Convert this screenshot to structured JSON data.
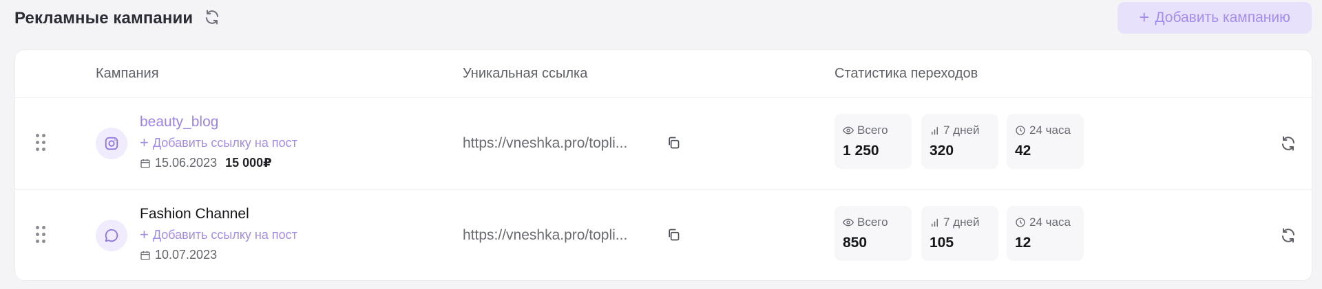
{
  "header": {
    "title": "Рекламные кампании",
    "add_button_label": "Добавить кампанию"
  },
  "table": {
    "columns": [
      "Кампания",
      "Уникальная ссылка",
      "Статистика переходов"
    ],
    "rows": [
      {
        "platform_icon": "instagram-icon",
        "name": "beauty_blog",
        "add_post_label": "Добавить ссылку на пост",
        "date": "15.06.2023",
        "price": "15 000₽",
        "url": "https://vneshka.pro/topli...",
        "stats": {
          "total_label": "Всего",
          "total": "1 250",
          "week_label": "7 дней",
          "week": "320",
          "day_label": "24 часа",
          "day": "42"
        }
      },
      {
        "platform_icon": "chat-bubble-icon",
        "name": "Fashion Channel",
        "add_post_label": "Добавить ссылку на пост",
        "date": "10.07.2023",
        "url": "https://vneshka.pro/topli...",
        "stats": {
          "total_label": "Всего",
          "total": "850",
          "week_label": "7 дней",
          "week": "105",
          "day_label": "24 часа",
          "day": "12"
        }
      }
    ]
  },
  "colors": {
    "accent": "#9b84e8",
    "accent_bg": "#e7e1fb",
    "page_bg": "#f4f4f7",
    "stat_bg": "#f7f7f9"
  }
}
